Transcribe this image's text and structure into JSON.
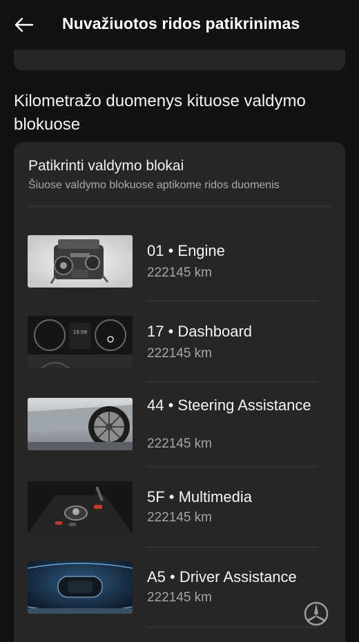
{
  "header": {
    "title": "Nuvažiuotos ridos patikrinimas",
    "back_icon": "arrow-left-icon"
  },
  "section": {
    "title": "Kilometražo duomenys kituose valdymo blokuose"
  },
  "card": {
    "title": "Patikrinti valdymo blokai",
    "subtitle": "Šiuose valdymo blokuose aptikome ridos duomenis"
  },
  "modules": [
    {
      "name": "01 • Engine",
      "km": "222145 km",
      "image": "engine-image"
    },
    {
      "name": "17 • Dashboard",
      "km": "222145 km",
      "image": "dashboard-image"
    },
    {
      "name": "44 • Steering Assistance",
      "km": "222145 km",
      "image": "wheel-image"
    },
    {
      "name": "5F • Multimedia",
      "km": "222145 km",
      "image": "multimedia-image"
    },
    {
      "name": "A5 • Driver Assistance",
      "km": "222145 km",
      "image": "driver-assistance-image"
    }
  ]
}
